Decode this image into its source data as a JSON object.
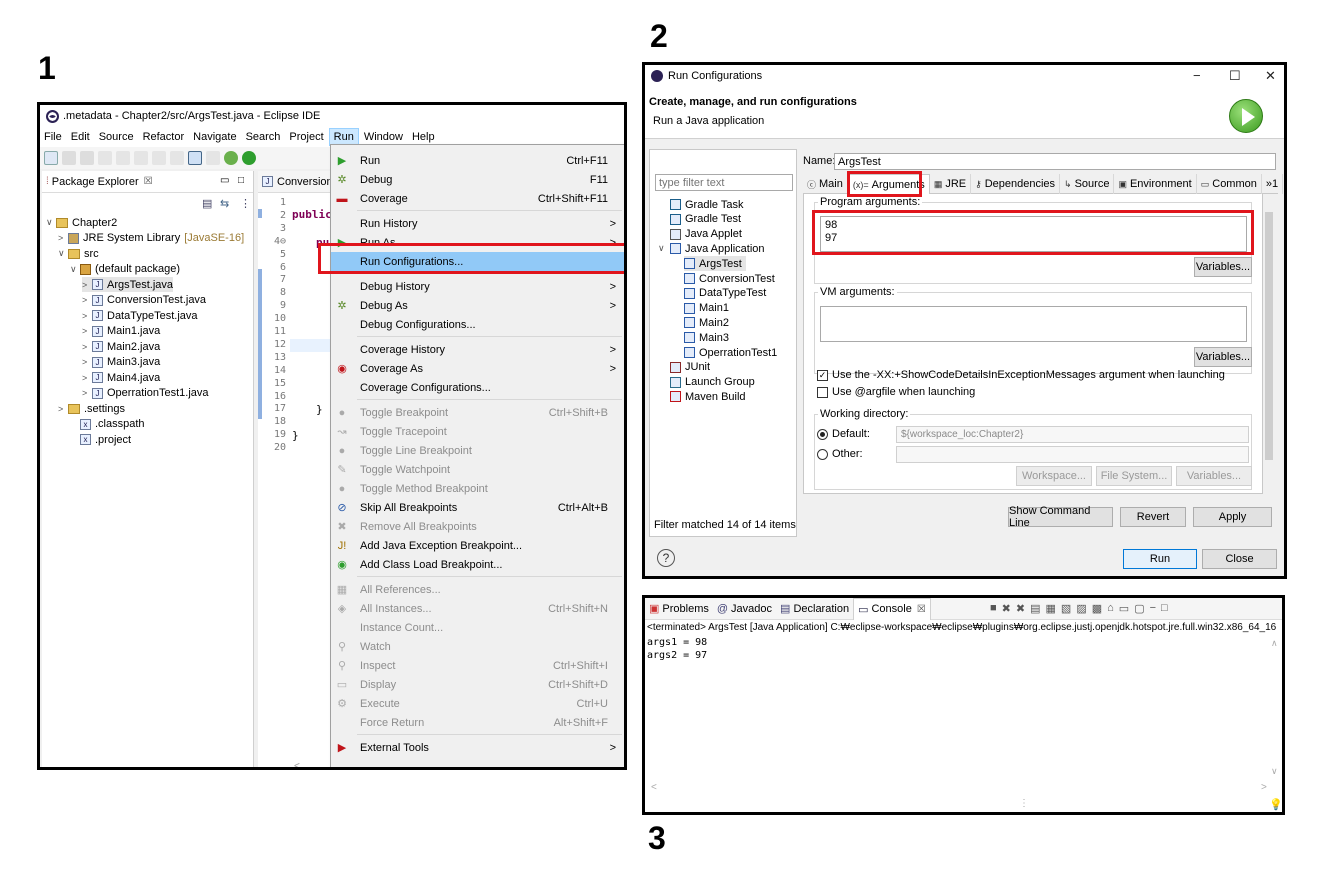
{
  "step_labels": [
    "1",
    "2",
    "3"
  ],
  "eclipse": {
    "window_title": ".metadata - Chapter2/src/ArgsTest.java - Eclipse IDE",
    "menu": [
      "File",
      "Edit",
      "Source",
      "Refactor",
      "Navigate",
      "Search",
      "Project",
      "Run",
      "Window",
      "Help"
    ],
    "package_explorer": {
      "tab_label": "Package Explorer",
      "tab_close": "☒",
      "items": [
        {
          "label": "Chapter2",
          "icon": "project-icon",
          "arrow": "∨"
        },
        {
          "label": "JRE System Library",
          "extra": "[JavaSE-16]",
          "icon": "library-icon",
          "arrow": ">"
        },
        {
          "label": "src",
          "icon": "source-folder-icon",
          "arrow": "∨"
        },
        {
          "label": "(default package)",
          "icon": "package-icon",
          "arrow": "∨"
        },
        {
          "label": "ArgsTest.java",
          "icon": "java-file-icon",
          "arrow": ">"
        },
        {
          "label": "ConversionTest.java",
          "icon": "java-file-icon",
          "arrow": ">"
        },
        {
          "label": "DataTypeTest.java",
          "icon": "java-file-icon",
          "arrow": ">"
        },
        {
          "label": "Main1.java",
          "icon": "java-file-icon",
          "arrow": ">"
        },
        {
          "label": "Main2.java",
          "icon": "java-file-icon",
          "arrow": ">"
        },
        {
          "label": "Main3.java",
          "icon": "java-file-icon",
          "arrow": ">"
        },
        {
          "label": "Main4.java",
          "icon": "java-file-icon",
          "arrow": ">"
        },
        {
          "label": "OperrationTest1.java",
          "icon": "java-file-icon",
          "arrow": ">"
        },
        {
          "label": ".settings",
          "icon": "folder-icon",
          "arrow": ">"
        },
        {
          "label": ".classpath",
          "icon": "xml-file-icon",
          "arrow": ""
        },
        {
          "label": ".project",
          "icon": "xml-file-icon",
          "arrow": ""
        }
      ]
    },
    "editor": {
      "tab_label": "Conversion",
      "line_numbers": [
        "1",
        "2",
        "3",
        "4⊖",
        "5",
        "6",
        "7",
        "8",
        "9",
        "10",
        "11",
        "12",
        "13",
        "14",
        "15",
        "16",
        "17",
        "18",
        "19",
        "20"
      ],
      "code": {
        "line2": "public",
        "line4": "pu",
        "line17": "}",
        "line19": "}"
      }
    },
    "run_menu": {
      "items": [
        {
          "label": "Run",
          "accel": "Ctrl+F11",
          "icon": "run-icon"
        },
        {
          "label": "Debug",
          "accel": "F11",
          "icon": "debug-icon"
        },
        {
          "label": "Coverage",
          "accel": "Ctrl+Shift+F11",
          "icon": "coverage-icon"
        },
        {
          "label": "Run History",
          "accel": ">",
          "icon": ""
        },
        {
          "label": "Run As",
          "accel": ">",
          "icon": "run-as-icon"
        },
        {
          "label": "Run Configurations...",
          "accel": "",
          "icon": ""
        },
        {
          "label": "Debug History",
          "accel": ">",
          "icon": ""
        },
        {
          "label": "Debug As",
          "accel": ">",
          "icon": "debug-as-icon"
        },
        {
          "label": "Debug Configurations...",
          "accel": "",
          "icon": ""
        },
        {
          "label": "Coverage History",
          "accel": ">",
          "icon": ""
        },
        {
          "label": "Coverage As",
          "accel": ">",
          "icon": "coverage-as-icon"
        },
        {
          "label": "Coverage Configurations...",
          "accel": "",
          "icon": ""
        },
        {
          "label": "Toggle Breakpoint",
          "accel": "Ctrl+Shift+B",
          "icon": "breakpoint-icon"
        },
        {
          "label": "Toggle Tracepoint",
          "accel": "",
          "icon": "tracepoint-icon"
        },
        {
          "label": "Toggle Line Breakpoint",
          "accel": "",
          "icon": "line-breakpoint-icon"
        },
        {
          "label": "Toggle Watchpoint",
          "accel": "",
          "icon": "watchpoint-icon"
        },
        {
          "label": "Toggle Method Breakpoint",
          "accel": "",
          "icon": "method-breakpoint-icon"
        },
        {
          "label": "Skip All Breakpoints",
          "accel": "Ctrl+Alt+B",
          "icon": "skip-breakpoints-icon"
        },
        {
          "label": "Remove All Breakpoints",
          "accel": "",
          "icon": "remove-breakpoints-icon"
        },
        {
          "label": "Add Java Exception Breakpoint...",
          "accel": "",
          "icon": "exception-breakpoint-icon"
        },
        {
          "label": "Add Class Load Breakpoint...",
          "accel": "",
          "icon": "class-load-breakpoint-icon"
        },
        {
          "label": "All References...",
          "accel": "",
          "icon": "references-icon"
        },
        {
          "label": "All Instances...",
          "accel": "Ctrl+Shift+N",
          "icon": "instances-icon"
        },
        {
          "label": "Instance Count...",
          "accel": "",
          "icon": ""
        },
        {
          "label": "Watch",
          "accel": "",
          "icon": "watch-icon"
        },
        {
          "label": "Inspect",
          "accel": "Ctrl+Shift+I",
          "icon": "inspect-icon"
        },
        {
          "label": "Display",
          "accel": "Ctrl+Shift+D",
          "icon": "display-icon"
        },
        {
          "label": "Execute",
          "accel": "Ctrl+U",
          "icon": "execute-icon"
        },
        {
          "label": "Force Return",
          "accel": "Alt+Shift+F",
          "icon": ""
        },
        {
          "label": "External Tools",
          "accel": ">",
          "icon": "external-tools-icon"
        }
      ]
    }
  },
  "run_config": {
    "window_title": "Run Configurations",
    "header_title": "Create, manage, and run configurations",
    "header_subtitle": "Run a Java application",
    "filter_placeholder": "type filter text",
    "tree": [
      {
        "label": "Gradle Task",
        "indent": 0,
        "arrow": ""
      },
      {
        "label": "Gradle Test",
        "indent": 0,
        "arrow": ""
      },
      {
        "label": "Java Applet",
        "indent": 0,
        "arrow": ""
      },
      {
        "label": "Java Application",
        "indent": 0,
        "arrow": "∨"
      },
      {
        "label": "ArgsTest",
        "indent": 1,
        "arrow": ""
      },
      {
        "label": "ConversionTest",
        "indent": 1,
        "arrow": ""
      },
      {
        "label": "DataTypeTest",
        "indent": 1,
        "arrow": ""
      },
      {
        "label": "Main1",
        "indent": 1,
        "arrow": ""
      },
      {
        "label": "Main2",
        "indent": 1,
        "arrow": ""
      },
      {
        "label": "Main3",
        "indent": 1,
        "arrow": ""
      },
      {
        "label": "OperrationTest1",
        "indent": 1,
        "arrow": ""
      },
      {
        "label": "JUnit",
        "indent": 0,
        "arrow": ""
      },
      {
        "label": "Launch Group",
        "indent": 0,
        "arrow": ""
      },
      {
        "label": "Maven Build",
        "indent": 0,
        "arrow": ""
      }
    ],
    "filter_status": "Filter matched 14 of 14 items",
    "name_label": "Name:",
    "name_value": "ArgsTest",
    "tabs": [
      {
        "label": "Main",
        "icon": "ⓒ"
      },
      {
        "label": "Arguments",
        "icon": "(x)="
      },
      {
        "label": "JRE",
        "icon": "▦"
      },
      {
        "label": "Dependencies",
        "icon": "⚷"
      },
      {
        "label": "Source",
        "icon": "↳"
      },
      {
        "label": "Environment",
        "icon": "▣"
      },
      {
        "label": "Common",
        "icon": "▭"
      },
      {
        "label": "»1",
        "icon": ""
      }
    ],
    "program_args_label": "Program arguments:",
    "program_args_lines": [
      "98",
      "97"
    ],
    "vm_args_label": "VM arguments:",
    "variables_label": "Variables...",
    "check_show_code": "Use the -XX:+ShowCodeDetailsInExceptionMessages argument when launching",
    "check_argfile": "Use @argfile when launching",
    "working_dir_label": "Working directory:",
    "default_label": "Default:",
    "default_value": "${workspace_loc:Chapter2}",
    "other_label": "Other:",
    "btn_workspace": "Workspace...",
    "btn_filesystem": "File System...",
    "btn_variables": "Variables...",
    "btn_show_cmd": "Show Command Line",
    "btn_revert": "Revert",
    "btn_apply": "Apply",
    "btn_run": "Run",
    "btn_close": "Close"
  },
  "console": {
    "tabs": [
      "Problems",
      "Javadoc",
      "Declaration",
      "Console"
    ],
    "terminated_line": "<terminated> ArgsTest [Java Application] C:₩eclipse-workspace₩eclipse₩plugins₩org.eclipse.justj.openjdk.hotspot.jre.full.win32.x86_64_16",
    "output": [
      "args1 = 98",
      "args2 = 97"
    ]
  }
}
